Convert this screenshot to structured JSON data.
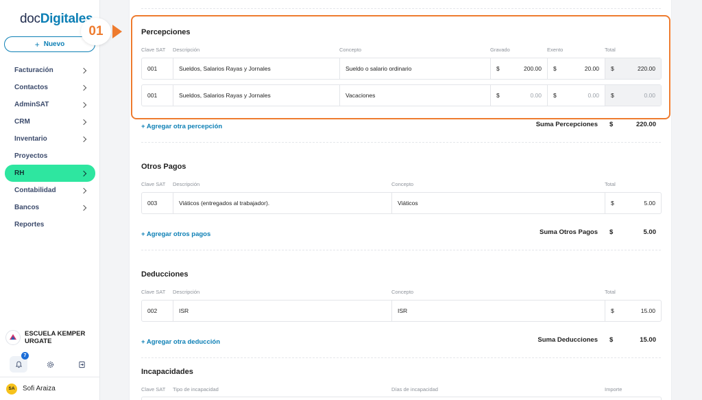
{
  "logo": {
    "prefix": "doc",
    "bold": "Digitales"
  },
  "new_button": {
    "plus": "+",
    "label": "Nuevo"
  },
  "nav": [
    {
      "label": "Facturación",
      "chevron": true,
      "active": false
    },
    {
      "label": "Contactos",
      "chevron": true,
      "active": false
    },
    {
      "label": "AdminSAT",
      "chevron": true,
      "active": false
    },
    {
      "label": "CRM",
      "chevron": true,
      "active": false
    },
    {
      "label": "Inventario",
      "chevron": true,
      "active": false
    },
    {
      "label": "Proyectos",
      "chevron": false,
      "active": false
    },
    {
      "label": "RH",
      "chevron": true,
      "active": true
    },
    {
      "label": "Contabilidad",
      "chevron": true,
      "active": false
    },
    {
      "label": "Bancos",
      "chevron": true,
      "active": false
    },
    {
      "label": "Reportes",
      "chevron": false,
      "active": false
    }
  ],
  "org": {
    "name_line1": "ESCUELA KEMPER",
    "name_line2": "URGATE"
  },
  "notifications": {
    "count": "7"
  },
  "user": {
    "initials": "SA",
    "name": "Sofi Araiza"
  },
  "callout": {
    "step": "01"
  },
  "colors": {
    "accent": "#0c7fb5",
    "active_nav": "#2ee6a0",
    "callout": "#ee7b2e",
    "badge": "#1c6ed8",
    "avatar": "#f6c21c"
  },
  "percepciones": {
    "title": "Percepciones",
    "headers": {
      "clave": "Clave SAT",
      "descripcion": "Descripción",
      "concepto": "Concepto",
      "gravado": "Gravado",
      "exento": "Exento",
      "total": "Total"
    },
    "rows": [
      {
        "clave": "001",
        "descripcion": "Sueldos, Salarios Rayas y Jornales",
        "concepto": "Sueldo o salario ordinario",
        "gravado_cur": "$",
        "gravado": "200.00",
        "exento_cur": "$",
        "exento": "20.00",
        "total_cur": "$",
        "total": "220.00"
      },
      {
        "clave": "001",
        "descripcion": "Sueldos, Salarios Rayas y Jornales",
        "concepto": "Vacaciones",
        "gravado_cur": "$",
        "gravado": "0.00",
        "exento_cur": "$",
        "exento": "0.00",
        "total_cur": "$",
        "total": "0.00"
      }
    ],
    "add_link": "+ Agregar otra percepción",
    "sum_label": "Suma Percepciones",
    "sum_cur": "$",
    "sum_value": "220.00"
  },
  "otros_pagos": {
    "title": "Otros Pagos",
    "headers": {
      "clave": "Clave SAT",
      "descripcion": "Descripción",
      "concepto": "Concepto",
      "total": "Total"
    },
    "rows": [
      {
        "clave": "003",
        "descripcion": "Viáticos (entregados al trabajador).",
        "concepto": "Viáticos",
        "total_cur": "$",
        "total": "5.00"
      }
    ],
    "add_link": "+ Agregar otros pagos",
    "sum_label": "Suma Otros Pagos",
    "sum_cur": "$",
    "sum_value": "5.00"
  },
  "deducciones": {
    "title": "Deducciones",
    "headers": {
      "clave": "Clave SAT",
      "descripcion": "Descripción",
      "concepto": "Concepto",
      "total": "Total"
    },
    "rows": [
      {
        "clave": "002",
        "descripcion": "ISR",
        "concepto": "ISR",
        "total_cur": "$",
        "total": "15.00"
      }
    ],
    "add_link": "+ Agregar otra deducción",
    "sum_label": "Suma Deducciones",
    "sum_cur": "$",
    "sum_value": "15.00"
  },
  "incapacidades": {
    "title": "Incapacidades",
    "headers": {
      "clave": "Clave SAT",
      "tipo": "Tipo de incapacidad",
      "dias": "Días de incapacidad",
      "importe": "Importe"
    }
  }
}
